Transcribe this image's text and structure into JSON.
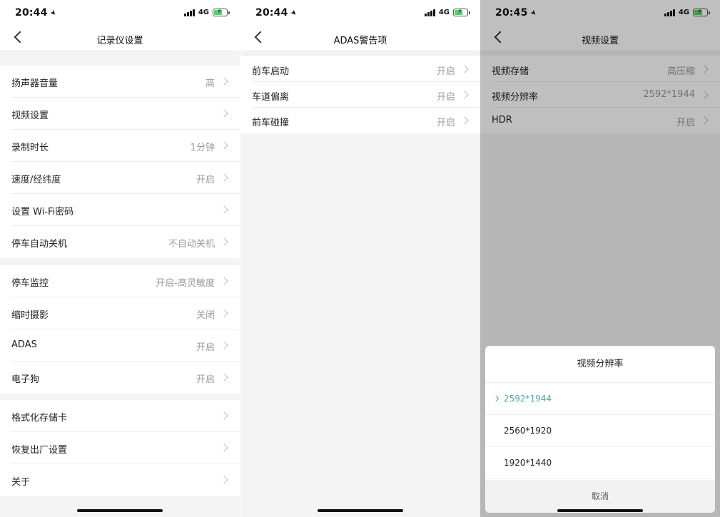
{
  "screen1": {
    "time": "20:44",
    "network": "4G",
    "title": "记录仪设置",
    "groups": [
      [
        {
          "label": "扬声器音量",
          "value": "高"
        },
        {
          "label": "视频设置",
          "value": ""
        },
        {
          "label": "录制时长",
          "value": "1分钟"
        },
        {
          "label": "速度/经纬度",
          "value": "开启"
        },
        {
          "label": "设置 Wi-Fi密码",
          "value": ""
        },
        {
          "label": "停车自动关机",
          "value": "不自动关机"
        }
      ],
      [
        {
          "label": "停车监控",
          "value": "开启-高灵敏度"
        },
        {
          "label": "缩时摄影",
          "value": "关闭"
        },
        {
          "label": "ADAS",
          "value": "开启"
        },
        {
          "label": "电子狗",
          "value": "开启"
        }
      ],
      [
        {
          "label": "格式化存储卡",
          "value": ""
        },
        {
          "label": "恢复出厂设置",
          "value": ""
        },
        {
          "label": "关于",
          "value": ""
        }
      ]
    ]
  },
  "screen2": {
    "time": "20:44",
    "network": "4G",
    "title": "ADAS警告项",
    "items": [
      {
        "label": "前车启动",
        "value": "开启"
      },
      {
        "label": "车道偏离",
        "value": "开启"
      },
      {
        "label": "前车碰撞",
        "value": "开启"
      }
    ]
  },
  "screen3": {
    "time": "20:45",
    "network": "4G",
    "title": "视频设置",
    "items": [
      {
        "label": "视频存储",
        "value": "高压缩"
      },
      {
        "label": "视频分辨率",
        "value": "2592*1944"
      },
      {
        "label": "HDR",
        "value": "开启"
      }
    ],
    "sheet": {
      "title": "视频分辨率",
      "options": [
        "2592*1944",
        "2560*1920",
        "1920*1440"
      ],
      "selected": "2592*1944",
      "cancel": "取消"
    }
  },
  "colors": {
    "accent": "#4fa7a6",
    "battery": "#4cd964",
    "value_text": "#9a9a9a"
  }
}
